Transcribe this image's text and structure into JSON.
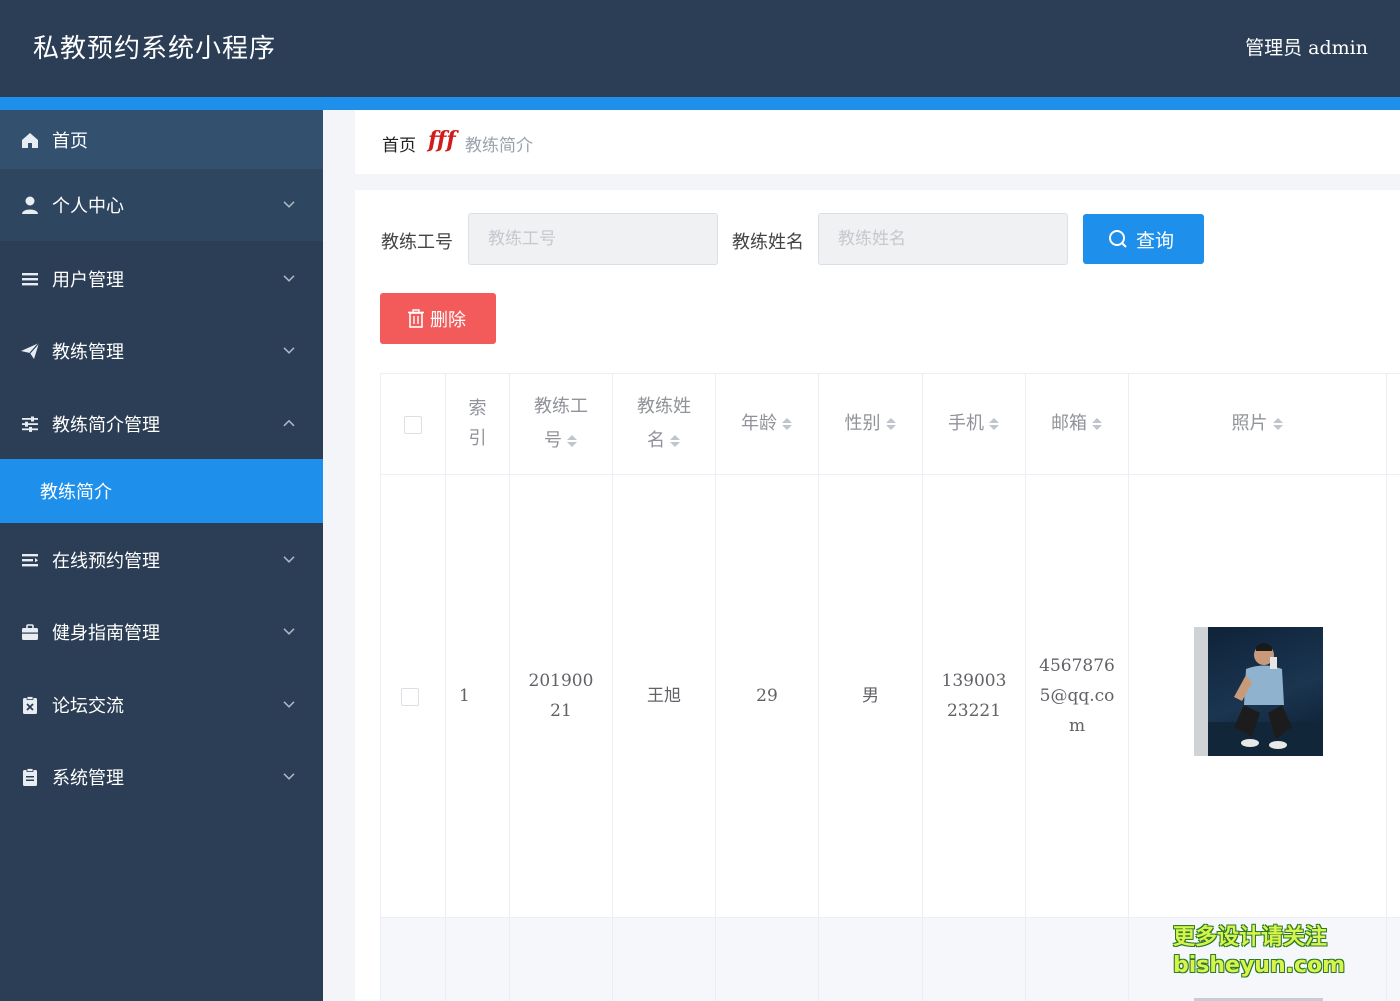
{
  "header": {
    "app_title": "私教预约系统小程序",
    "admin_label": "管理员 admin"
  },
  "sidebar": {
    "items": [
      {
        "label": "首页",
        "icon": "home-icon"
      },
      {
        "label": "个人中心",
        "icon": "user-icon"
      },
      {
        "label": "用户管理",
        "icon": "list-icon"
      },
      {
        "label": "教练管理",
        "icon": "paper-plane-icon"
      },
      {
        "label": "教练简介管理",
        "icon": "sliders-icon"
      },
      {
        "label": "在线预约管理",
        "icon": "align-icon"
      },
      {
        "label": "健身指南管理",
        "icon": "briefcase-icon"
      },
      {
        "label": "论坛交流",
        "icon": "clipboard-icon"
      },
      {
        "label": "系统管理",
        "icon": "document-icon"
      }
    ],
    "active_sub": "教练简介"
  },
  "breadcrumb": {
    "home": "首页",
    "separator": "fff",
    "current": "教练简介"
  },
  "search": {
    "coach_id_label": "教练工号",
    "coach_id_placeholder": "教练工号",
    "coach_name_label": "教练姓名",
    "coach_name_placeholder": "教练姓名",
    "query_label": "查询",
    "delete_label": "删除"
  },
  "table": {
    "headers": {
      "index": "索引",
      "coach_id": "教练工号",
      "coach_name": "教练姓名",
      "age": "年龄",
      "gender": "性别",
      "phone": "手机",
      "email": "邮箱",
      "photo": "照片"
    },
    "rows": [
      {
        "index": "1",
        "coach_id": "20190021",
        "coach_name": "王旭",
        "age": "29",
        "gender": "男",
        "phone": "13900323221",
        "email": "45678765@qq.com"
      }
    ]
  },
  "watermark": {
    "line1": "更多设计请关注",
    "line2": "bisheyun.com"
  },
  "colors": {
    "header_bg": "#2c3e55",
    "accent_blue": "#1e90ec",
    "delete_red": "#f35b5b"
  }
}
